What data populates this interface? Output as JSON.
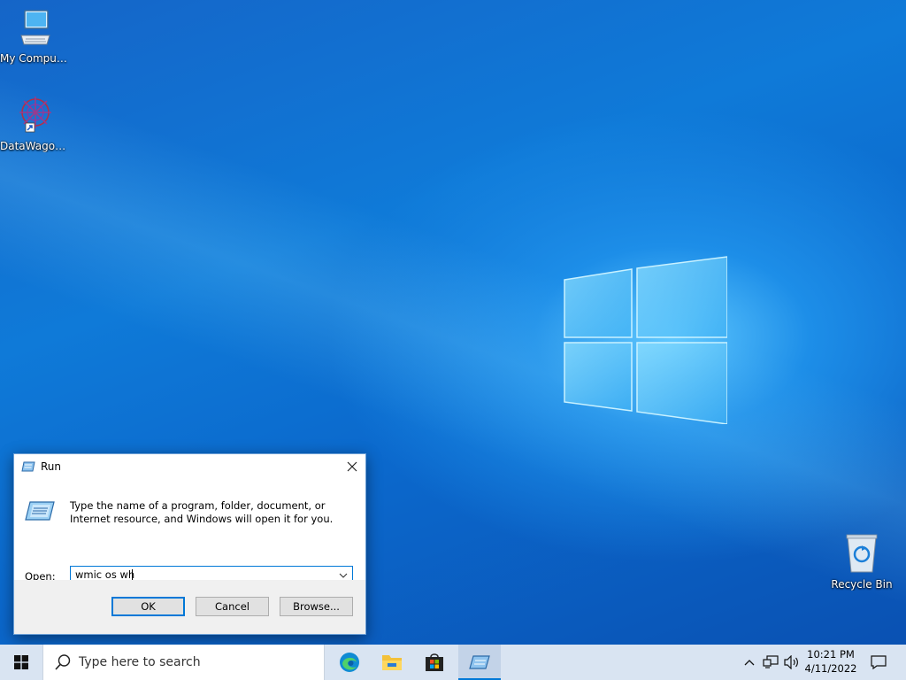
{
  "desktop": {
    "icons": [
      {
        "label": "My Computer",
        "icon": "monitor-icon"
      },
      {
        "label": "DataWagon...",
        "icon": "datawagon-shortcut-icon"
      },
      {
        "label": "Recycle Bin",
        "icon": "recycle-bin-icon"
      }
    ]
  },
  "run_dialog": {
    "title": "Run",
    "description": "Type the name of a program, folder, document, or Internet resource, and Windows will open it for you.",
    "open_label": "Open:",
    "input_value": "wmic os wh",
    "buttons": {
      "ok": "OK",
      "cancel": "Cancel",
      "browse": "Browse..."
    }
  },
  "taskbar": {
    "search_placeholder": "Type here to search",
    "apps": [
      "edge-icon",
      "file-explorer-icon",
      "store-icon",
      "run-icon"
    ],
    "clock": {
      "time": "10:21 PM",
      "date": "4/11/2022"
    }
  },
  "colors": {
    "accent": "#0078d7",
    "taskbar": "#d9e4f2",
    "desktop": "#0b6bd0"
  }
}
